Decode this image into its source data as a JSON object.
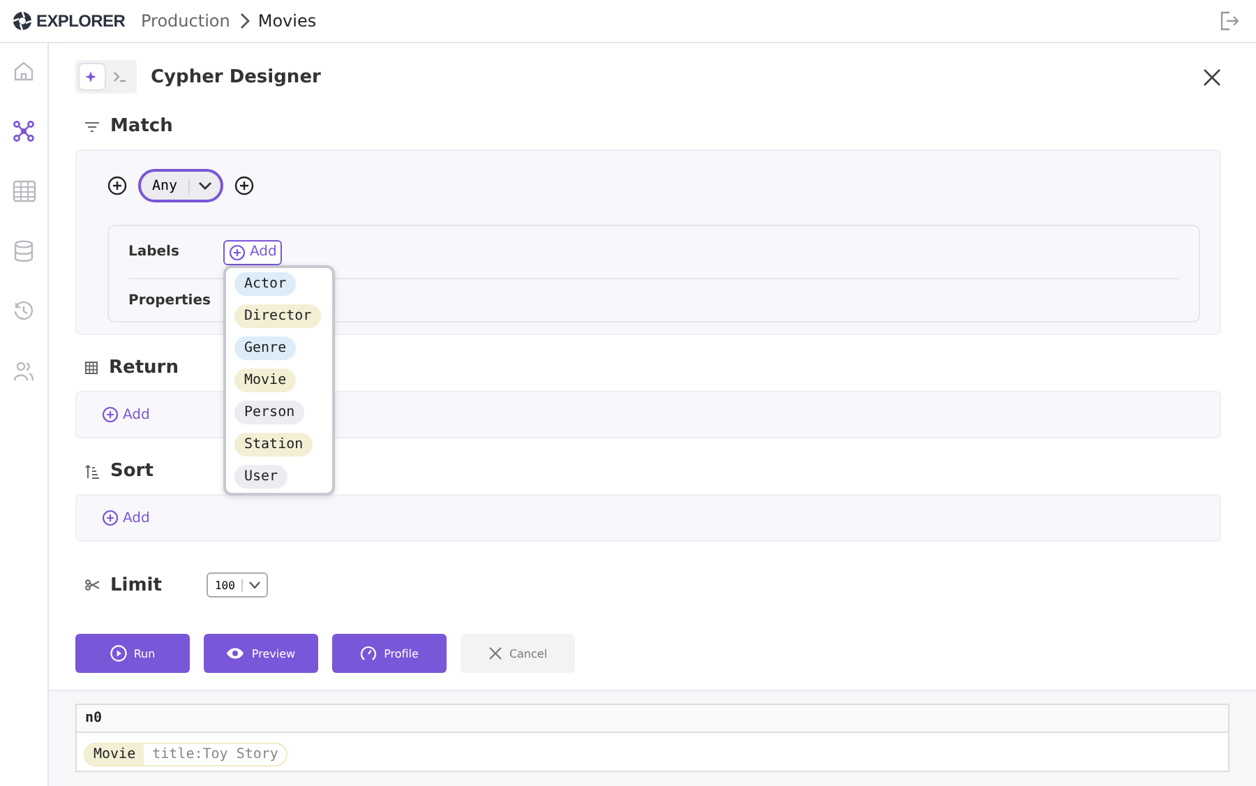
{
  "header": {
    "logo": "EXPLORER",
    "breadcrumb": [
      "Production",
      "Movies"
    ]
  },
  "sidebar": {
    "items": [
      {
        "kind": "home",
        "selected": false
      },
      {
        "kind": "graph",
        "selected": true
      },
      {
        "kind": "table",
        "selected": false
      },
      {
        "kind": "database",
        "selected": false
      },
      {
        "kind": "history",
        "selected": false
      },
      {
        "kind": "users",
        "selected": false
      }
    ]
  },
  "designer": {
    "title": "Cypher Designer",
    "modes": [
      {
        "kind": "visual",
        "selected": true
      },
      {
        "kind": "terminal",
        "selected": false
      }
    ]
  },
  "match": {
    "title": "Match",
    "selector": "Any",
    "labels_label": "Labels",
    "add": "Add",
    "properties_label": "Properties",
    "dropdown": [
      {
        "label": "Actor",
        "color": "#dcedf9"
      },
      {
        "label": "Director",
        "color": "#f3efd5"
      },
      {
        "label": "Genre",
        "color": "#dcedf9"
      },
      {
        "label": "Movie",
        "color": "#f3efd5"
      },
      {
        "label": "Person",
        "color": "#ececf1"
      },
      {
        "label": "Station",
        "color": "#f3efd5"
      },
      {
        "label": "User",
        "color": "#ececf1"
      }
    ]
  },
  "return": {
    "title": "Return",
    "add": "Add"
  },
  "sort": {
    "title": "Sort",
    "add": "Add"
  },
  "limit": {
    "title": "Limit",
    "value": "100"
  },
  "buttons": [
    {
      "kind": "run",
      "label": "Run"
    },
    {
      "kind": "preview",
      "label": "Preview"
    },
    {
      "kind": "profile",
      "label": "Profile"
    },
    {
      "kind": "cancel",
      "label": "Cancel"
    }
  ],
  "results": {
    "column": "n0",
    "rows": [
      {
        "label": "Movie",
        "property": "title:Toy Story"
      }
    ]
  }
}
